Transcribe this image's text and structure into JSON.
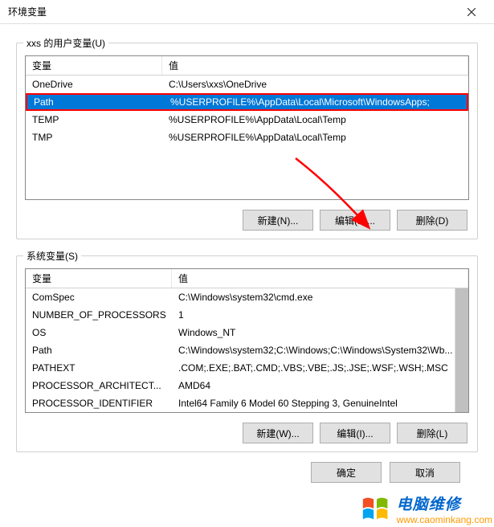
{
  "titlebar": {
    "title": "环境变量"
  },
  "user_section": {
    "label": "xxs 的用户变量(U)",
    "headers": {
      "name": "变量",
      "value": "值"
    },
    "rows": [
      {
        "name": "OneDrive",
        "value": "C:\\Users\\xxs\\OneDrive",
        "selected": false
      },
      {
        "name": "Path",
        "value": "%USERPROFILE%\\AppData\\Local\\Microsoft\\WindowsApps;",
        "selected": true
      },
      {
        "name": "TEMP",
        "value": "%USERPROFILE%\\AppData\\Local\\Temp",
        "selected": false
      },
      {
        "name": "TMP",
        "value": "%USERPROFILE%\\AppData\\Local\\Temp",
        "selected": false
      }
    ],
    "buttons": {
      "new": "新建(N)...",
      "edit": "编辑(E)...",
      "delete": "删除(D)"
    }
  },
  "system_section": {
    "label": "系统变量(S)",
    "headers": {
      "name": "变量",
      "value": "值"
    },
    "rows": [
      {
        "name": "ComSpec",
        "value": "C:\\Windows\\system32\\cmd.exe"
      },
      {
        "name": "NUMBER_OF_PROCESSORS",
        "value": "1"
      },
      {
        "name": "OS",
        "value": "Windows_NT"
      },
      {
        "name": "Path",
        "value": "C:\\Windows\\system32;C:\\Windows;C:\\Windows\\System32\\Wb..."
      },
      {
        "name": "PATHEXT",
        "value": ".COM;.EXE;.BAT;.CMD;.VBS;.VBE;.JS;.JSE;.WSF;.WSH;.MSC"
      },
      {
        "name": "PROCESSOR_ARCHITECT...",
        "value": "AMD64"
      },
      {
        "name": "PROCESSOR_IDENTIFIER",
        "value": "Intel64 Family 6 Model 60 Stepping 3, GenuineIntel"
      }
    ],
    "buttons": {
      "new": "新建(W)...",
      "edit": "编辑(I)...",
      "delete": "删除(L)"
    }
  },
  "dialog_buttons": {
    "ok": "确定",
    "cancel": "取消"
  },
  "watermark": {
    "title": "电脑维修",
    "url": "www.caominkang.com"
  }
}
